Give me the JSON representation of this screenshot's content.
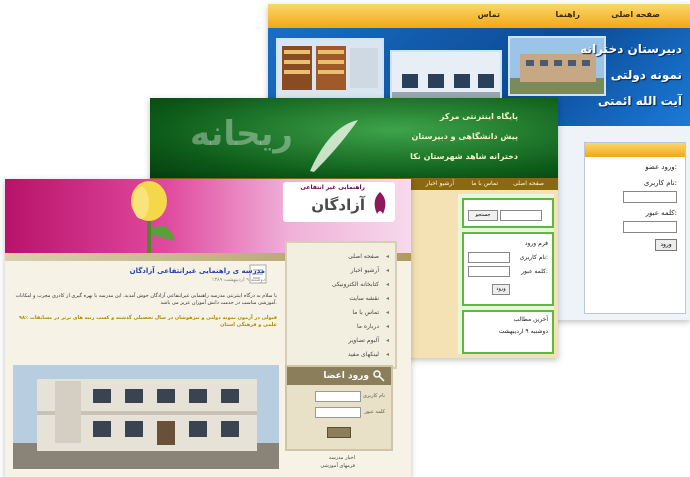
{
  "screens": {
    "blue_site": {
      "nav": [
        "صفحه اصلی",
        "راهنما",
        "تماس"
      ],
      "banner_lines": [
        "دبیرستان دخترانه",
        "نمونه دولتی",
        "آیت الله ائمتی"
      ],
      "login_labels": [
        "ورود عضو:",
        "نام کاربری:",
        "کلمه عبور:"
      ],
      "login_button": "ورود"
    },
    "green_site": {
      "banner_lines": [
        "پایگاه اینترنتی مرکز",
        "پیش دانشگاهی و دبیرستان",
        "دخترانه شاهد شهرستان نکا"
      ],
      "banner_word": "ریحانه",
      "nav": [
        "صفحه اصلی",
        "تماس با ما",
        "آرشیو اخبار"
      ],
      "search_button": "جستجو",
      "login_labels": [
        "نام کاربری:",
        "کلمه عبور:"
      ],
      "login_title": "فرم ورود",
      "login_button": "ورود",
      "news_title": "آخرین مطالب",
      "date_line": "دوشنبه ۹ اردیبهشت"
    },
    "pink_site": {
      "logo_small": "راهنمایی غیر انتفاعی",
      "logo_big": "آزادگان",
      "menu": [
        "صفحه اصلی",
        "آرشیو اخبار",
        "کتابخانه الکترونیکی",
        "نقشه سایت",
        "تماس با ما",
        "درباره ما",
        "آلبوم تصاویر",
        "لینکهای مفید"
      ],
      "article_title": "مدرسه ی راهنمایی غیرانتفاعی آزادگان",
      "article_date": "دوشنبه ۹ اردیبهشت ۱۳۸۹",
      "article_para": "با سلام به درگاه اینترنتی مدرسه راهنمایی غیرانتفاعی آزادگان خوش آمدید. این مدرسه با بهره گیری از کادری مجرب و امکانات آموزشی مناسب در خدمت دانش آموزان عزیز می باشد.",
      "highlight_para": "۹۸٪ قبولی در آزمون نمونه دولتی و تیزهوشان در سال تحصیلی گذشته و کسب رتبه های برتر در مسابقات علمی و فرهنگی استان",
      "login_title": "ورود اعضا",
      "login_labels": [
        "نام کاربری",
        "کلمه عبور"
      ],
      "footer_links": [
        "اخبار مدرسه",
        "فرمهای آموزشی"
      ]
    }
  },
  "colors": {
    "blue_banner": "#0c4b96",
    "orange_nav": "#f0a818",
    "green_banner": "#0c5a18",
    "pink_header": "#e04a9e"
  }
}
